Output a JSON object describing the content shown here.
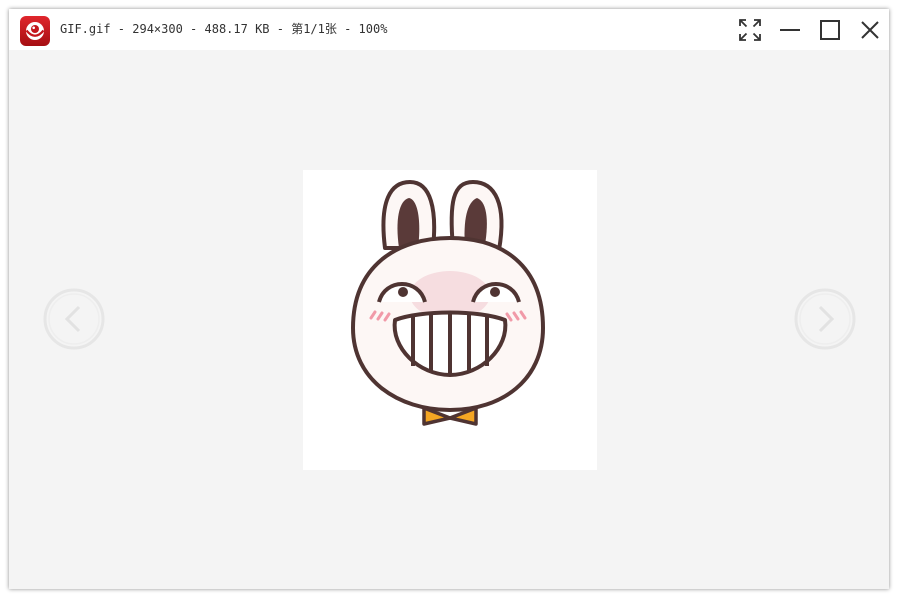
{
  "window": {
    "title": "GIF.gif - 294×300 - 488.17 KB - 第1/1张 - 100%"
  },
  "icons": {
    "app": "app-logo-icon",
    "fullscreen": "fullscreen-icon",
    "minimize": "minimize-icon",
    "maximize": "maximize-icon",
    "close": "close-icon",
    "prev": "chevron-left-icon",
    "next": "chevron-right-icon"
  },
  "colors": {
    "app_icon": "#c4161c",
    "background": "#f4f4f4",
    "titlebar": "#ffffff"
  }
}
